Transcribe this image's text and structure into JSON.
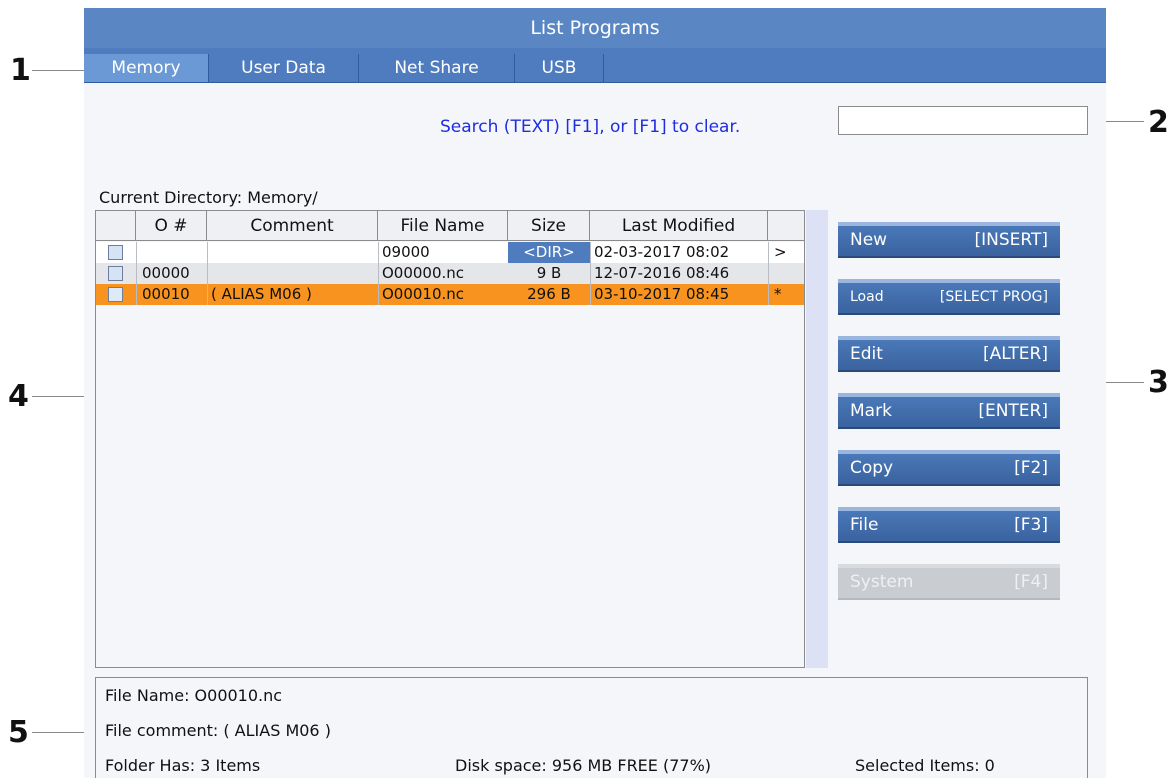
{
  "window": {
    "title": "List Programs"
  },
  "tabs": [
    {
      "label": "Memory",
      "active": true
    },
    {
      "label": "User Data",
      "active": false
    },
    {
      "label": "Net Share",
      "active": false
    },
    {
      "label": "USB",
      "active": false
    }
  ],
  "search": {
    "hint": "Search (TEXT) [F1], or [F1] to clear.",
    "value": ""
  },
  "current_directory": "Current Directory: Memory/",
  "table": {
    "columns": [
      "",
      "O #",
      "Comment",
      "File Name",
      "Size",
      "Last Modified",
      ""
    ],
    "rows": [
      {
        "onum": "",
        "comment": "",
        "filename": "09000",
        "size": "<DIR>",
        "modified": "02-03-2017 08:02",
        "flag": ">",
        "selected": false
      },
      {
        "onum": "00000",
        "comment": "",
        "filename": "O00000.nc",
        "size": "9 B",
        "modified": "12-07-2016 08:46",
        "flag": "",
        "selected": false
      },
      {
        "onum": "00010",
        "comment": "( ALIAS M06 )",
        "filename": "O00010.nc",
        "size": "296 B",
        "modified": "03-10-2017 08:45",
        "flag": "*",
        "selected": true
      }
    ]
  },
  "buttons": [
    {
      "label": "New",
      "key": "[INSERT]",
      "enabled": true
    },
    {
      "label": "Load",
      "key": "[SELECT PROG]",
      "enabled": true
    },
    {
      "label": "Edit",
      "key": "[ALTER]",
      "enabled": true
    },
    {
      "label": "Mark",
      "key": "[ENTER]",
      "enabled": true
    },
    {
      "label": "Copy",
      "key": "[F2]",
      "enabled": true
    },
    {
      "label": "File",
      "key": "[F3]",
      "enabled": true
    },
    {
      "label": "System",
      "key": "[F4]",
      "enabled": false
    }
  ],
  "info": {
    "file_name": "File Name: O00010.nc",
    "file_comment": "File comment: ( ALIAS M06 )",
    "folder_has": "Folder Has: 3 Items",
    "disk_space": "Disk space: 956 MB FREE (77%)",
    "selected_items": "Selected Items: 0"
  },
  "callouts": [
    "1",
    "2",
    "3",
    "4",
    "5"
  ],
  "colors": {
    "title_bar": "#5a87c4",
    "tab_active": "#6a99d6",
    "selected_row": "#f7931e",
    "dir_size_cell": "#4f7cbe",
    "search_hint": "#1f2de0",
    "button": "#3a639f",
    "button_disabled": "#c9ccd1"
  }
}
